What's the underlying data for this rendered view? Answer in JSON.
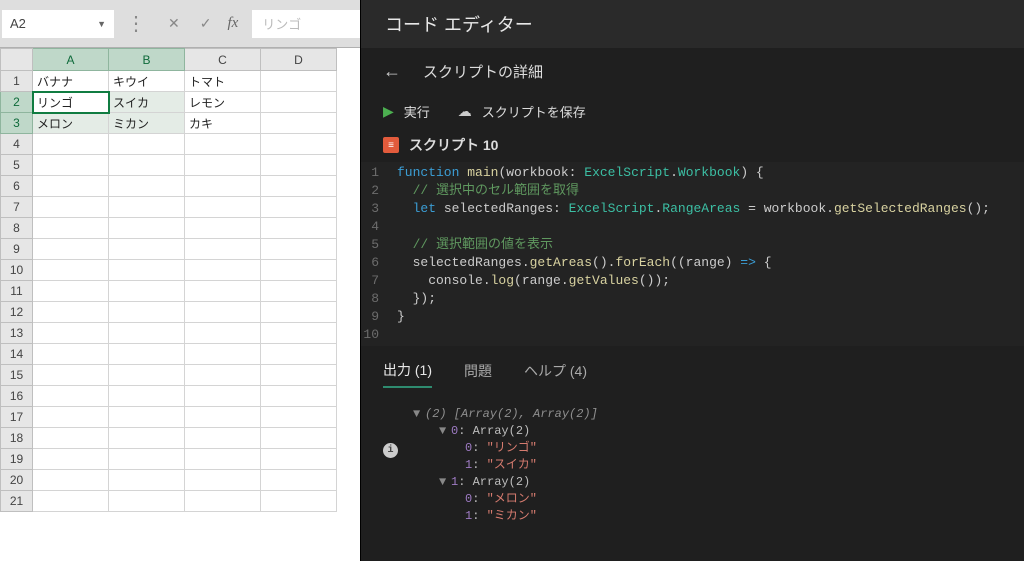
{
  "formula_bar": {
    "cell_ref": "A2",
    "value_preview": "リンゴ"
  },
  "grid": {
    "columns": [
      "A",
      "B",
      "C",
      "D"
    ],
    "row_count": 21,
    "data": {
      "1": [
        "バナナ",
        "キウイ",
        "トマト",
        ""
      ],
      "2": [
        "リンゴ",
        "スイカ",
        "レモン",
        ""
      ],
      "3": [
        "メロン",
        "ミカン",
        "カキ",
        ""
      ]
    },
    "selection": {
      "r1": 2,
      "c1": 1,
      "r2": 3,
      "c2": 2,
      "active": {
        "r": 2,
        "c": 1
      }
    }
  },
  "editor": {
    "title": "コード エディター",
    "detail_title": "スクリプトの詳細",
    "run_label": "実行",
    "save_label": "スクリプトを保存",
    "script_label": "スクリプト 10",
    "code_lines": [
      {
        "n": 1,
        "seg": [
          [
            "kw",
            "function "
          ],
          [
            "fn",
            "main"
          ],
          [
            "punc",
            "(workbook: "
          ],
          [
            "type",
            "ExcelScript"
          ],
          [
            "punc",
            "."
          ],
          [
            "type",
            "Workbook"
          ],
          [
            "punc",
            ") {"
          ]
        ]
      },
      {
        "n": 2,
        "seg": [
          [
            "punc",
            "  "
          ],
          [
            "cmt",
            "// 選択中のセル範囲を取得"
          ]
        ]
      },
      {
        "n": 3,
        "seg": [
          [
            "punc",
            "  "
          ],
          [
            "kw",
            "let "
          ],
          [
            "punc",
            "selectedRanges: "
          ],
          [
            "type",
            "ExcelScript"
          ],
          [
            "punc",
            "."
          ],
          [
            "type",
            "RangeAreas"
          ],
          [
            "punc",
            " = workbook."
          ],
          [
            "fn",
            "getSelectedRanges"
          ],
          [
            "punc",
            "();"
          ]
        ]
      },
      {
        "n": 4,
        "seg": [
          [
            "punc",
            " "
          ]
        ]
      },
      {
        "n": 5,
        "seg": [
          [
            "punc",
            "  "
          ],
          [
            "cmt",
            "// 選択範囲の値を表示"
          ]
        ]
      },
      {
        "n": 6,
        "seg": [
          [
            "punc",
            "  selectedRanges."
          ],
          [
            "fn",
            "getAreas"
          ],
          [
            "punc",
            "()."
          ],
          [
            "fn",
            "forEach"
          ],
          [
            "punc",
            "((range) "
          ],
          [
            "kw",
            "=>"
          ],
          [
            "punc",
            " {"
          ]
        ]
      },
      {
        "n": 7,
        "seg": [
          [
            "punc",
            "    console."
          ],
          [
            "fn",
            "log"
          ],
          [
            "punc",
            "(range."
          ],
          [
            "fn",
            "getValues"
          ],
          [
            "punc",
            "());"
          ]
        ]
      },
      {
        "n": 8,
        "seg": [
          [
            "punc",
            "  });"
          ]
        ]
      },
      {
        "n": 9,
        "seg": [
          [
            "punc",
            "}"
          ]
        ]
      },
      {
        "n": 10,
        "seg": [
          [
            "punc",
            ""
          ]
        ]
      }
    ]
  },
  "tabs": {
    "output": "出力 (1)",
    "problems": "問題",
    "help": "ヘルプ (4)"
  },
  "output_tree": {
    "summary": "(2) [Array(2), Array(2)]",
    "rows": [
      {
        "indent": 1,
        "caret": "▼",
        "key": "0",
        "label": ": Array(2)"
      },
      {
        "indent": 2,
        "caret": " ",
        "key": "0",
        "str": "\"リンゴ\""
      },
      {
        "indent": 2,
        "caret": " ",
        "key": "1",
        "str": "\"スイカ\""
      },
      {
        "indent": 1,
        "caret": "▼",
        "key": "1",
        "label": ": Array(2)"
      },
      {
        "indent": 2,
        "caret": " ",
        "key": "0",
        "str": "\"メロン\""
      },
      {
        "indent": 2,
        "caret": " ",
        "key": "1",
        "str": "\"ミカン\""
      }
    ]
  }
}
